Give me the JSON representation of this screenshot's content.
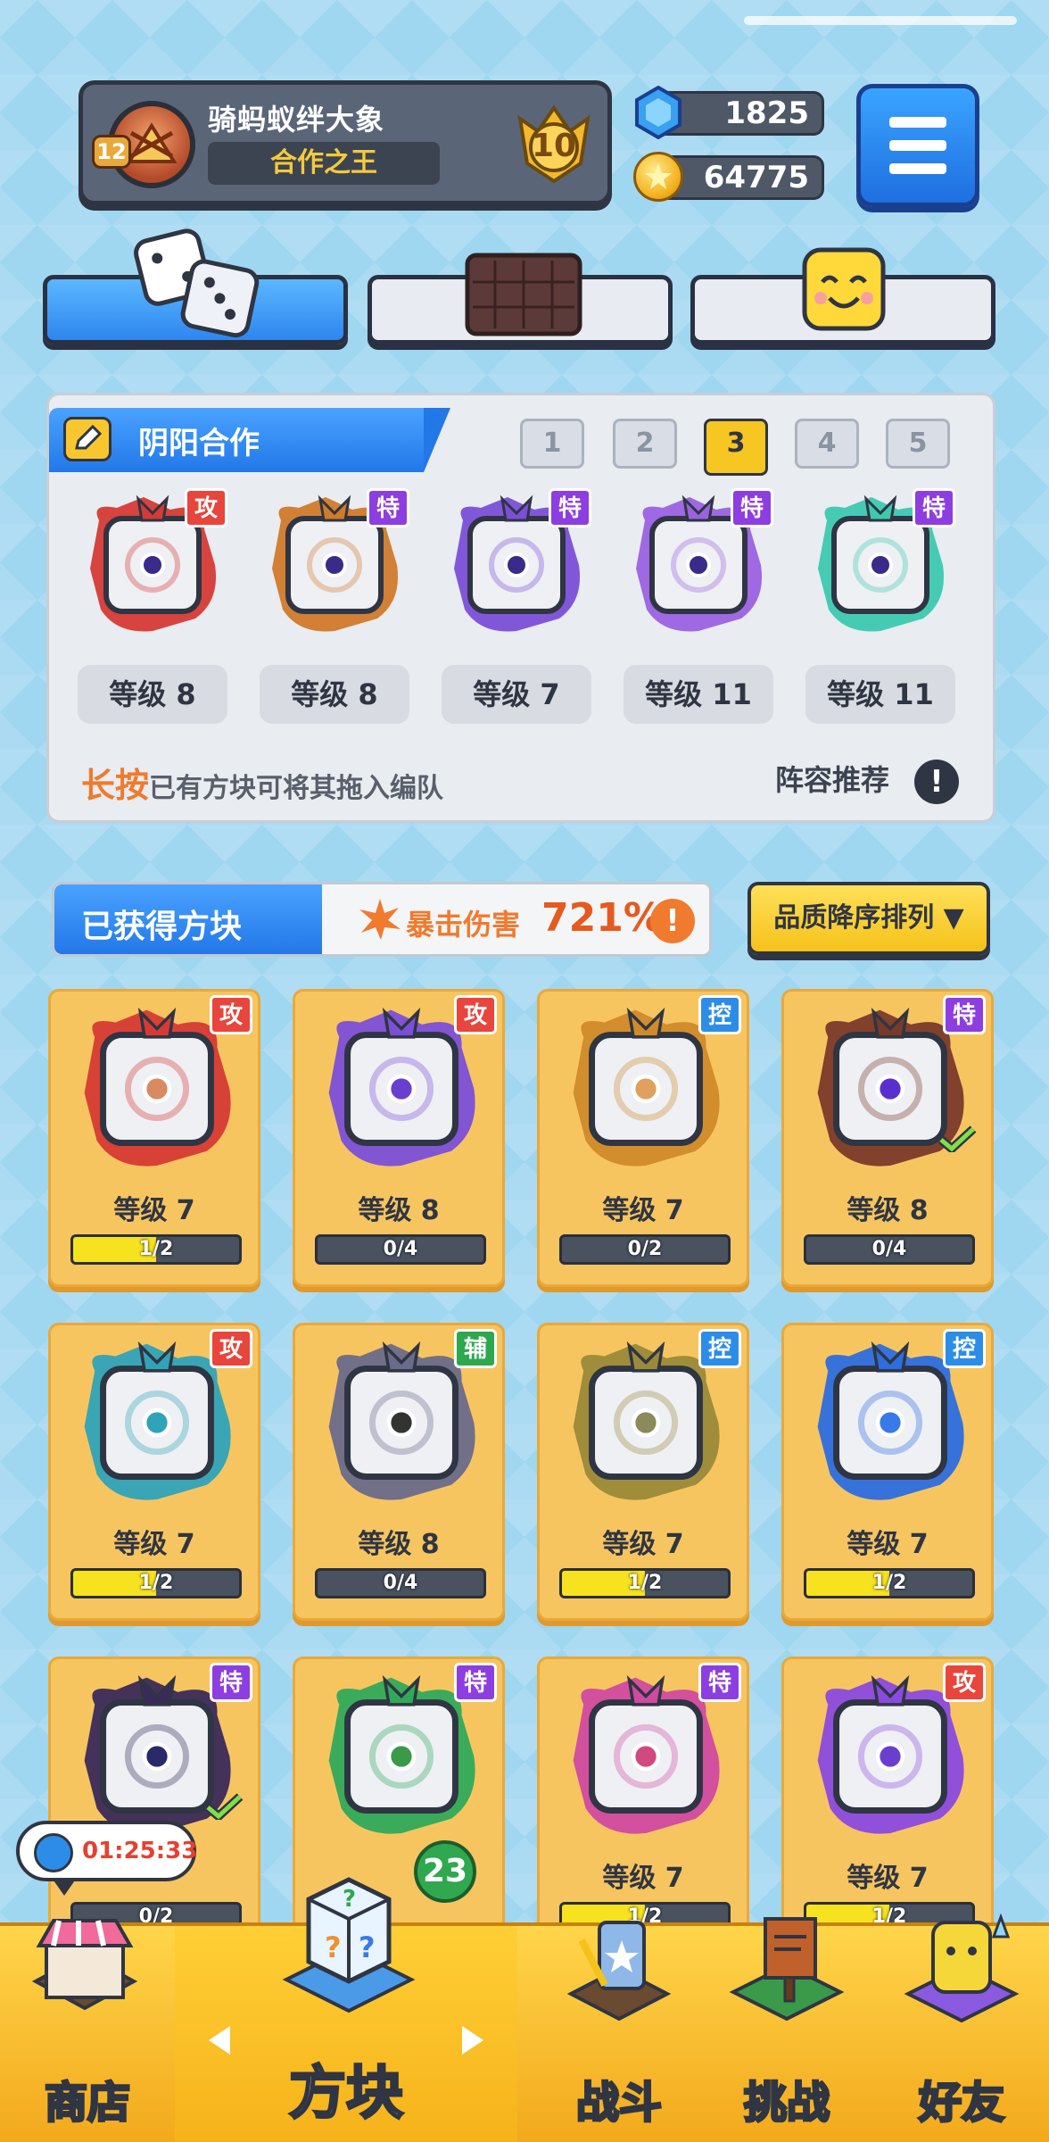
{
  "profile": {
    "level": "12",
    "name": "骑蚂蚁绊大象",
    "title": "合作之王",
    "rank": "10"
  },
  "currency": {
    "gems": "1825",
    "coins": "64775"
  },
  "team": {
    "name": "阴阳合作",
    "slots": [
      "1",
      "2",
      "3",
      "4",
      "5"
    ],
    "active_slot": "3",
    "dice": [
      {
        "badge": "攻",
        "type": "attack",
        "level": "等级 8",
        "color": "#d63a34"
      },
      {
        "badge": "特",
        "type": "special",
        "level": "等级 8",
        "color": "#d07a2a"
      },
      {
        "badge": "特",
        "type": "special",
        "level": "等级 7",
        "color": "#7b4fd8"
      },
      {
        "badge": "特",
        "type": "special",
        "level": "等级 11",
        "color": "#9a62e0"
      },
      {
        "badge": "特",
        "type": "special",
        "level": "等级 11",
        "color": "#3cc9b0"
      }
    ],
    "hint_highlight": "长按",
    "hint_rest": "已有方块可将其拖入编队",
    "recommend_label": "阵容推荐",
    "recommend_icon": "!"
  },
  "collection": {
    "title": "已获得方块",
    "crit_label": "暴击伤害",
    "crit_value": "721%",
    "crit_info": "!",
    "sort_label": "品质降序排列 ▼",
    "cards": [
      {
        "badge": "攻",
        "level": "等级 7",
        "progress": "1/2",
        "fill": 0.5,
        "color": "#d63a34",
        "dot": "#d98a60",
        "checked": false
      },
      {
        "badge": "攻",
        "level": "等级 8",
        "progress": "0/4",
        "fill": 0,
        "color": "#7b4fd8",
        "dot": "#6a3fcf",
        "checked": false
      },
      {
        "badge": "控",
        "level": "等级 7",
        "progress": "0/2",
        "fill": 0,
        "color": "#d08a2a",
        "dot": "#e0a060",
        "checked": false
      },
      {
        "badge": "特",
        "level": "等级 8",
        "progress": "0/4",
        "fill": 0,
        "color": "#7a3a2a",
        "dot": "#5a2fcf",
        "checked": true
      },
      {
        "badge": "攻",
        "level": "等级 7",
        "progress": "1/2",
        "fill": 0.5,
        "color": "#2fa3b8",
        "dot": "#2fa3b8",
        "checked": false
      },
      {
        "badge": "辅",
        "level": "等级 8",
        "progress": "0/4",
        "fill": 0,
        "color": "#6a6a8a",
        "dot": "#333",
        "checked": false
      },
      {
        "badge": "控",
        "level": "等级 7",
        "progress": "1/2",
        "fill": 0.5,
        "color": "#9a8a3a",
        "dot": "#8a8a5a",
        "checked": false
      },
      {
        "badge": "控",
        "level": "等级 7",
        "progress": "1/2",
        "fill": 0.5,
        "color": "#2c6ee0",
        "dot": "#3a7ae8",
        "checked": false
      },
      {
        "badge": "特",
        "level": "",
        "progress": "0/2",
        "fill": 0,
        "color": "#3a2a5a",
        "dot": "#2a2a6a",
        "checked": true
      },
      {
        "badge": "特",
        "level": "",
        "progress": "",
        "fill": 0,
        "color": "#2faa5a",
        "dot": "#3a9a4a",
        "checked": false
      },
      {
        "badge": "特",
        "level": "等级 7",
        "progress": "1/2",
        "fill": 0.5,
        "color": "#d04aa0",
        "dot": "#d04a80",
        "checked": false
      },
      {
        "badge": "攻",
        "level": "等级 7",
        "progress": "1/2",
        "fill": 0.5,
        "color": "#8a4ae0",
        "dot": "#6a3fcf",
        "checked": false
      }
    ]
  },
  "timer": "01:25:33",
  "dice_count": "23",
  "nav": {
    "shop": "商店",
    "dice": "方块",
    "battle": "战斗",
    "challenge": "挑战",
    "friends": "好友"
  }
}
